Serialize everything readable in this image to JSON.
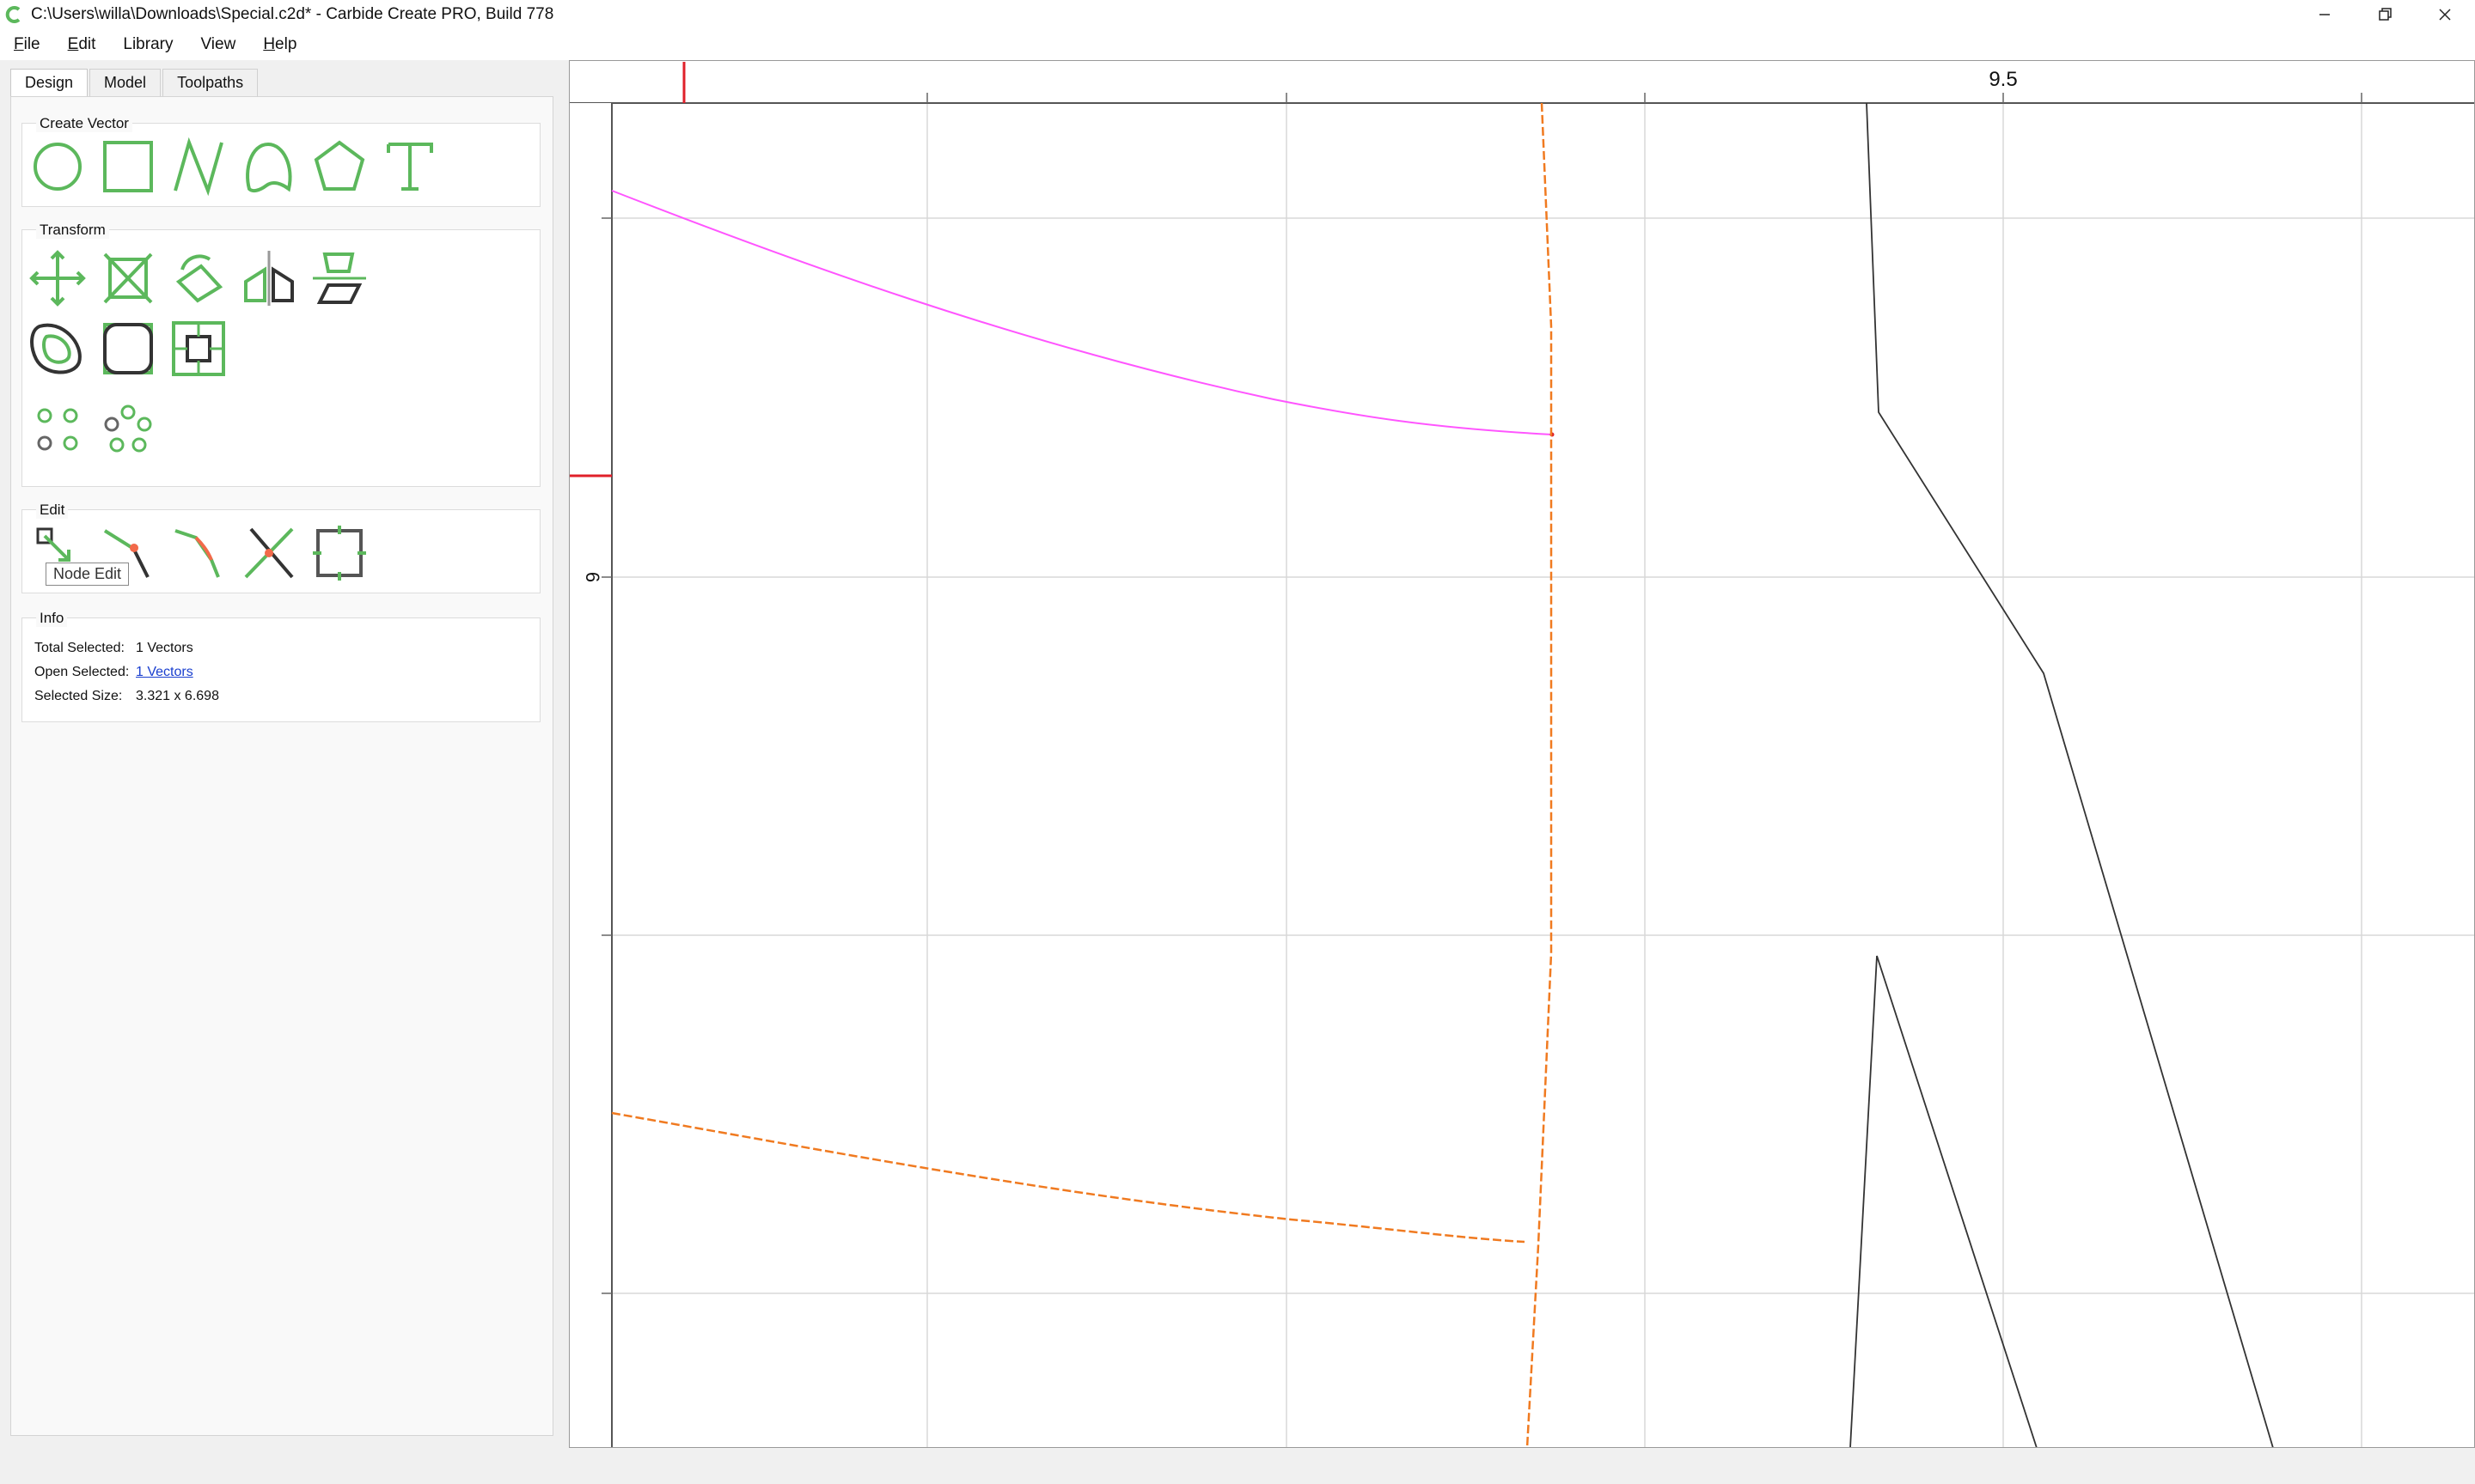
{
  "window": {
    "title": "C:\\Users\\willa\\Downloads\\Special.c2d* - Carbide Create PRO, Build 778",
    "icon": "carbide-logo-icon",
    "controls": [
      "minimize-icon",
      "restore-icon",
      "close-icon"
    ]
  },
  "menu": {
    "items": [
      {
        "label": "File",
        "mnemonic": "F",
        "rest": "ile"
      },
      {
        "label": "Edit",
        "mnemonic": "E",
        "rest": "dit"
      },
      {
        "label": "Library",
        "mnemonic": "",
        "rest": "Library"
      },
      {
        "label": "View",
        "mnemonic": "",
        "rest": "View"
      },
      {
        "label": "Help",
        "mnemonic": "H",
        "rest": "elp"
      }
    ]
  },
  "tabs": [
    {
      "label": "Design",
      "active": true
    },
    {
      "label": "Model",
      "active": false
    },
    {
      "label": "Toolpaths",
      "active": false
    }
  ],
  "groups": {
    "create_vector": {
      "title": "Create Vector",
      "tools": [
        "circle-icon",
        "rectangle-icon",
        "polyline-icon",
        "curve-icon",
        "polygon-icon",
        "text-icon"
      ]
    },
    "transform": {
      "title": "Transform",
      "tools": [
        "move-icon",
        "scale-icon",
        "rotate-icon",
        "mirror-icon",
        "align-icon",
        "offset-icon",
        "fillet-icon",
        "boundary-icon",
        "linear-array-icon",
        "circular-array-icon"
      ]
    },
    "edit": {
      "title": "Edit",
      "tools": [
        "node-edit-icon",
        "split-icon",
        "join-icon",
        "trim-icon",
        "bounding-box-icon"
      ],
      "tooltip": "Node Edit"
    },
    "info": {
      "title": "Info",
      "rows": [
        {
          "label": "Total Selected:",
          "value": "1 Vectors",
          "link": false
        },
        {
          "label": "Open Selected:",
          "value": "1 Vectors",
          "link": true
        },
        {
          "label": "Selected Size:",
          "value": "3.321 x 6.698",
          "link": false
        }
      ]
    }
  },
  "canvas": {
    "top_ruler_label": "9.5",
    "left_ruler_label": "6",
    "colors": {
      "selected_vector": "#ff55ff",
      "toolpath_vector": "#f07a20",
      "vector": "#333333",
      "grid": "#d8d8d8",
      "cursor_marker": "#e0202a",
      "accent_green": "#5cb85c"
    }
  }
}
